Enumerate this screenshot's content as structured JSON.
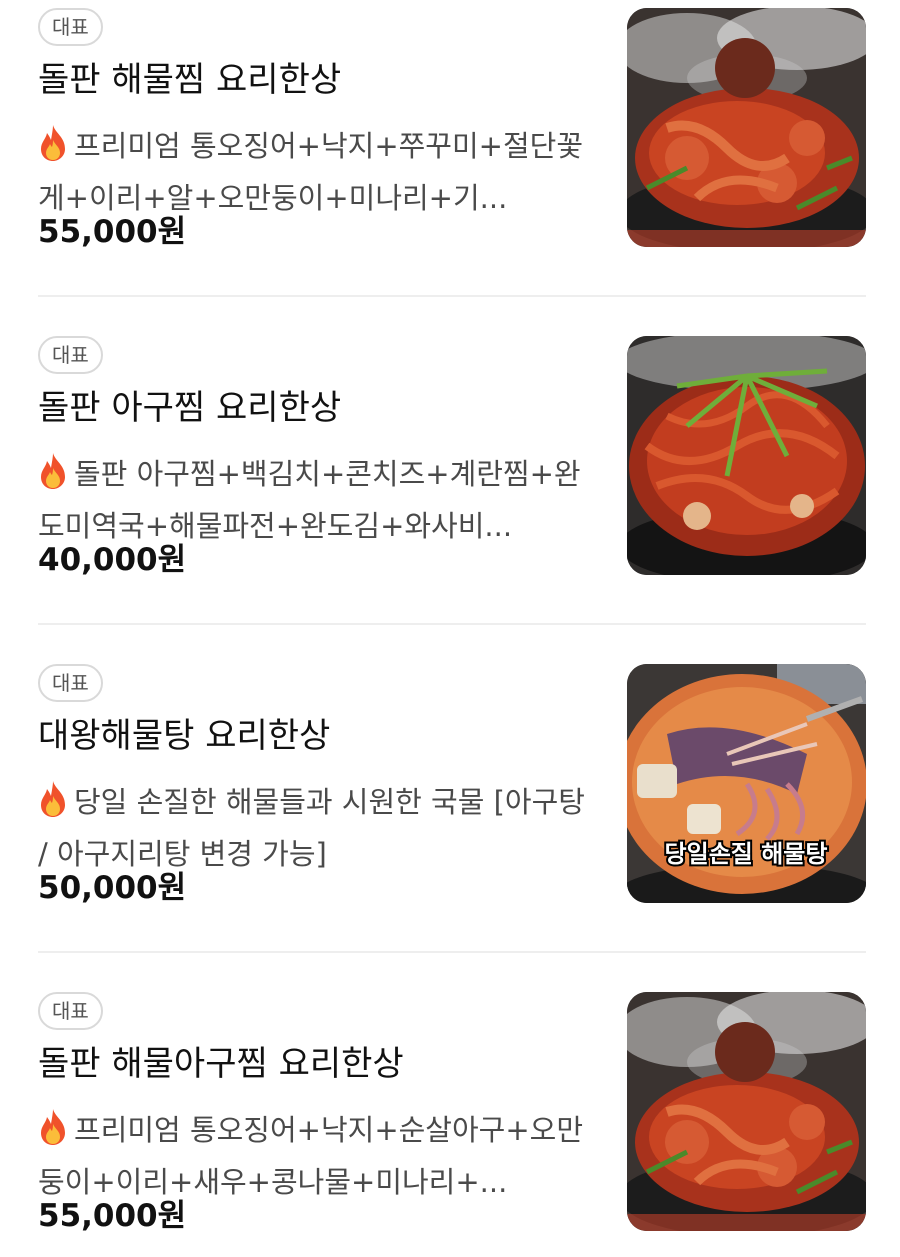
{
  "colors": {
    "badge_border": "#d9d9d9",
    "badge_text": "#555555",
    "title_text": "#111111",
    "desc_text": "#4a4a4a",
    "price_text": "#111111",
    "divider": "#eeeeee"
  },
  "menu_items": [
    {
      "badge": "대표",
      "title": "돌판 해물찜 요리한상",
      "icon": "fire-emoji",
      "description": "프리미엄 통오징어+낙지+쭈꾸미+절단꽃게+이리+알+오만둥이+미나리+기...",
      "price": "55,000원",
      "image_subject": "seafood-jjim-stone-plate"
    },
    {
      "badge": "대표",
      "title": "돌판 아구찜 요리한상",
      "icon": "fire-emoji",
      "description": "돌판 아구찜+백김치+콘치즈+계란찜+완도미역국+해물파전+완도김+와사비...",
      "price": "40,000원",
      "image_subject": "monkfish-jjim-stone-plate"
    },
    {
      "badge": "대표",
      "title": "대왕해물탕 요리한상",
      "icon": "fire-emoji",
      "description": "당일 손질한 해물들과 시원한 국물 [아구탕 / 아구지리탕 변경 가능]",
      "price": "50,000원",
      "image_subject": "seafood-stew-pot",
      "image_caption": "당일손질 해물탕"
    },
    {
      "badge": "대표",
      "title": "돌판 해물아구찜 요리한상",
      "icon": "fire-emoji",
      "description": "프리미엄 통오징어+낙지+순살아구+오만둥이+이리+새우+콩나물+미나리+...",
      "price": "55,000원",
      "image_subject": "seafood-jjim-stone-plate"
    }
  ]
}
